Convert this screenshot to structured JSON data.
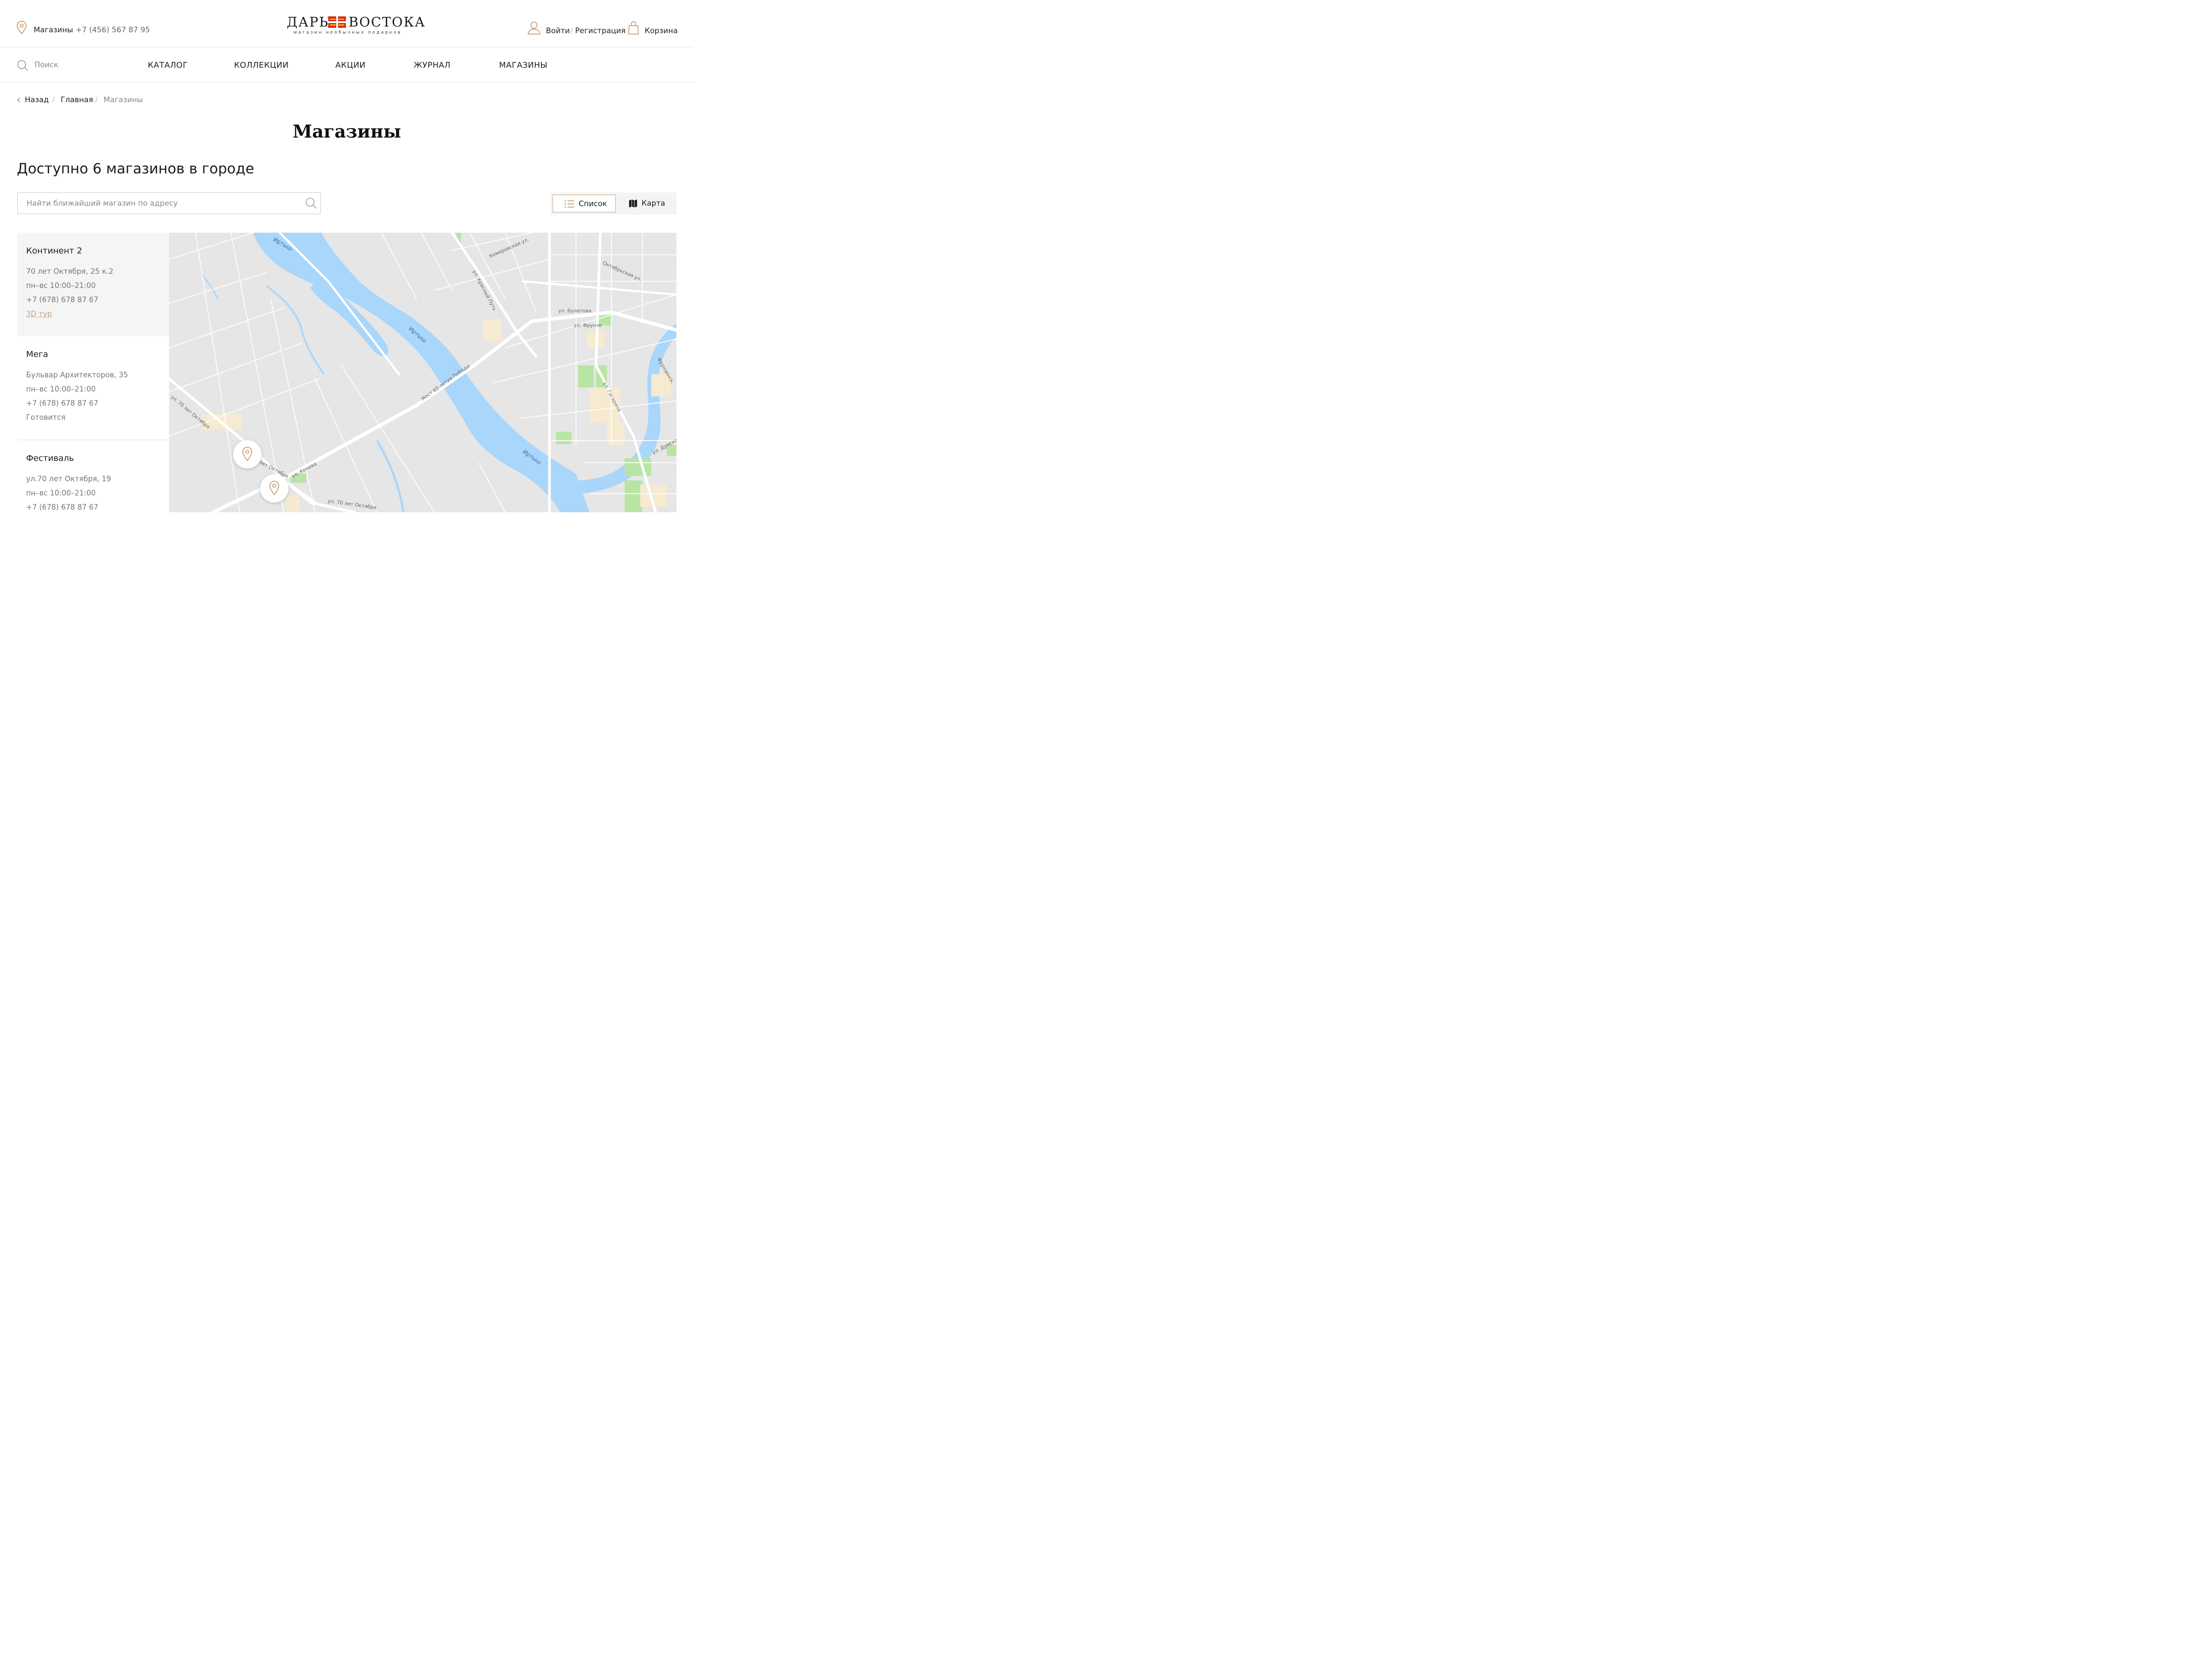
{
  "header": {
    "stores_link": "Магазины",
    "phone": "+7 (456) 567 87 95",
    "logo": {
      "word_left": "ДАРЫ",
      "word_right": "ВОСТОКА",
      "tagline": "магазин необычных подарков"
    },
    "login": "Войти",
    "slash": "/",
    "register": "Регистрация",
    "cart": "Корзина"
  },
  "nav": {
    "search_placeholder": "Поиск",
    "items": [
      "КАТАЛОГ",
      "КОЛЛЕКЦИИ",
      "АКЦИИ",
      "ЖУРНАЛ",
      "МАГАЗИНЫ"
    ]
  },
  "breadcrumb": {
    "back": "Назад",
    "items": [
      "Главная",
      "Магазины"
    ],
    "separator": "/"
  },
  "page_title": "Магазины",
  "available_text": "Доступно 6 магазинов в городе",
  "address_search": {
    "placeholder": "Найти ближайший магазин по адресу"
  },
  "view_toggle": {
    "list": "Список",
    "map": "Карта",
    "active": "list"
  },
  "stores": [
    {
      "name": "Континент 2",
      "address": "70 лет Октября, 25 к.2",
      "hours": "пн–вс 10:00–21:00",
      "phone": "+7 (678) 678 87 67",
      "extra": "3D тур",
      "extra_is_link": true
    },
    {
      "name": "Мега",
      "address": "Бульвар Архитекторов, 35",
      "hours": "пн–вс 10:00–21:00",
      "phone": "+7 (678) 678 87 67",
      "extra": "Готовится",
      "extra_is_link": false
    },
    {
      "name": "Фестиваль",
      "address": "ул.70 лет Октября, 19",
      "hours": "пн–вс 10:00–21:00",
      "phone": "+7 (678) 678 87 67"
    }
  ],
  "map": {
    "labels": {
      "irtysh": "Иртыш",
      "irtysh_top": "Иртыш",
      "kemerovskaya": "Кемеровская ул.",
      "oktyabrskaya": "Октябрьская ул.",
      "krasny_put": "ул. Красный Путь",
      "bulatova": "ул. Булатова",
      "frunze": "ул. Фрунзе",
      "frunzenskaya": "Фрунзенск.",
      "gagarina": "ул. Гагарина",
      "bridge": "Мост 60-летия Победы",
      "okt70_a": "ул. 70 лет Октября",
      "okt70_b": "лет Октября",
      "okt70_c": "ул. 70 лет Октября",
      "koneva": "ул. Конева",
      "dumskaya": "ул. Думска"
    }
  },
  "colors": {
    "accent": "#c9a27a",
    "water": "#a9d6fb",
    "park": "#b8e5a4",
    "building": "#f6ead0",
    "map_bg": "#e6e6e6"
  }
}
